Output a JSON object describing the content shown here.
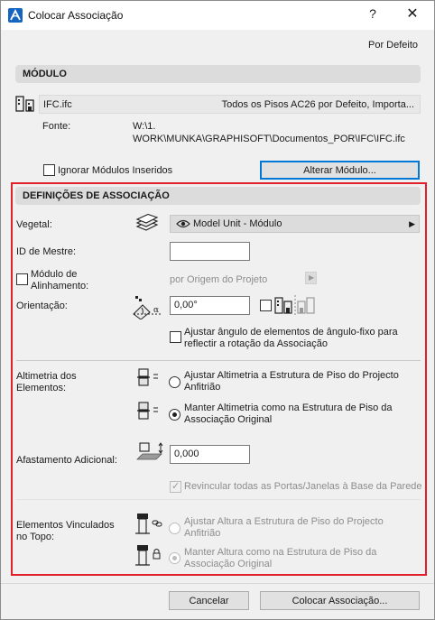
{
  "window": {
    "title": "Colocar Associação",
    "help_glyph": "?",
    "close_glyph": "✕"
  },
  "top_link": "Por Defeito",
  "module_section": {
    "header": "MÓDULO",
    "file_name": "IFC.ifc",
    "file_info": "Todos os Pisos AC26 por Defeito, Importa...",
    "source_label": "Fonte:",
    "source_path_line1": "W:\\1.",
    "source_path_line2": "WORK\\MUNKA\\GRAPHISOFT\\Documentos_POR\\IFC\\IFC.ifc",
    "ignore_nested_label": "Ignorar Módulos Inseridos",
    "change_module_button": "Alterar Módulo..."
  },
  "association_section": {
    "header": "DEFINIÇÕES DE ASSOCIAÇÃO",
    "vegetal_label": "Vegetal:",
    "vegetal_value": "Model Unit - Módulo",
    "master_id_label": "ID de Mestre:",
    "master_id_value": "",
    "align_label_line1": "Módulo de",
    "align_label_line2": "Alinhamento:",
    "align_value": "por Origem do Projeto",
    "orientation_label": "Orientação:",
    "orientation_value": "0,00°",
    "adjust_angle_line1": "Ajustar ângulo de elementos de ângulo-fixo para",
    "adjust_angle_line2": "reflectir a rotação da Associação",
    "elevation_label_line1": "Altimetria dos",
    "elevation_label_line2": "Elementos:",
    "elevation_opt1_line1": "Ajustar Altimetria a Estrutura de Piso do Projecto",
    "elevation_opt1_line2": "Anfitrião",
    "elevation_opt2_line1": "Manter Altimetria como na Estrutura de Piso da",
    "elevation_opt2_line2": "Associação Original",
    "offset_label": "Afastamento Adicional:",
    "offset_value": "0,000",
    "relink_label": "Revincular todas as Portas/Janelas à Base da Parede",
    "top_linked_label_line1": "Elementos Vinculados",
    "top_linked_label_line2": "no Topo:",
    "top_opt1_line1": "Ajustar Altura a Estrutura de Piso do Projecto",
    "top_opt1_line2": "Anfitrião",
    "top_opt2_line1": "Manter Altura como na Estrutura de Piso da",
    "top_opt2_line2": "Associação Original"
  },
  "footer": {
    "cancel_button": "Cancelar",
    "place_button": "Colocar Associação..."
  },
  "colors": {
    "highlight_frame": "#e0202a",
    "primary_button_border": "#0078d7"
  }
}
